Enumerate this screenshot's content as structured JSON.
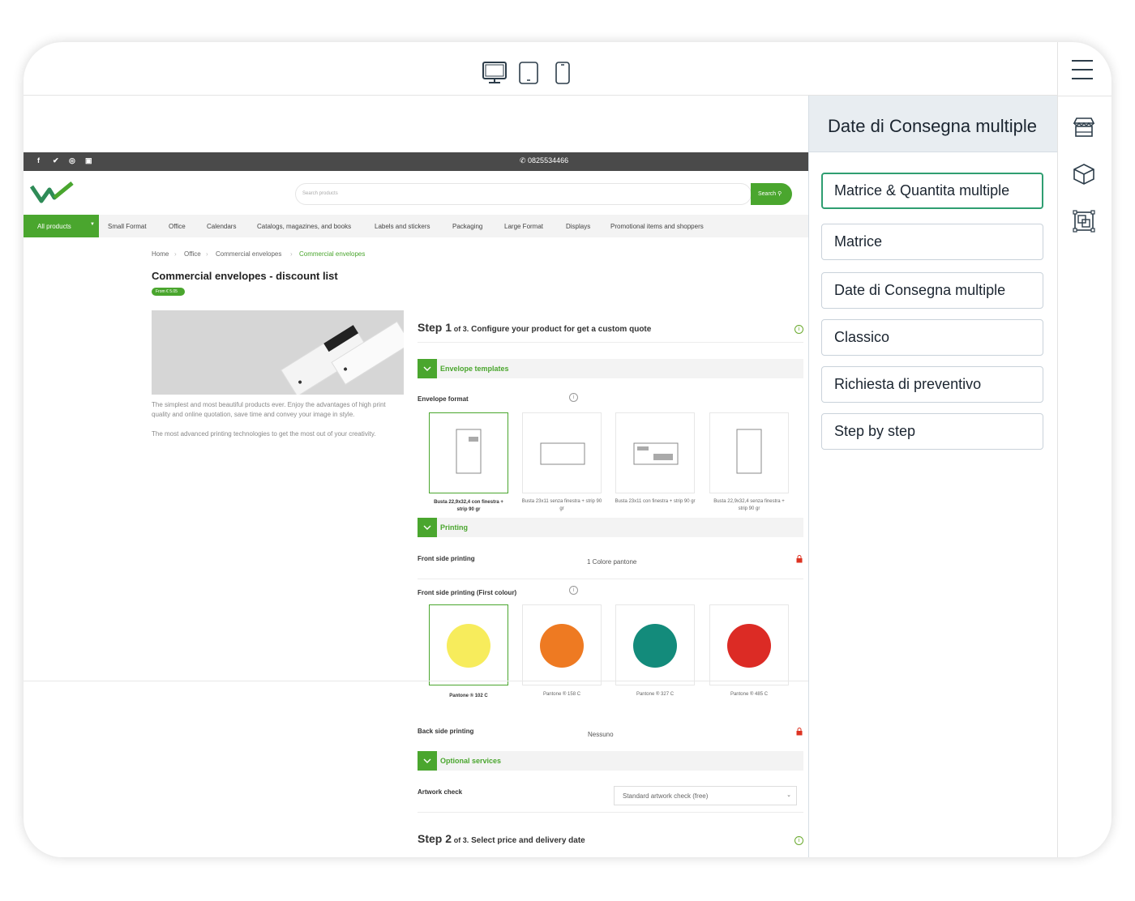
{
  "builder": {
    "device_toggles": [
      "desktop-icon",
      "tablet-icon",
      "mobile-icon"
    ],
    "panel_title": "Date di Consegna multiple",
    "options": [
      {
        "label": "Matrice & Quantita multiple",
        "active": true
      },
      {
        "label": "Matrice",
        "active": false
      },
      {
        "label": "Date di Consegna multiple",
        "active": false
      },
      {
        "label": "Classico",
        "active": false
      },
      {
        "label": "Richiesta di preventivo",
        "active": false
      },
      {
        "label": "Step by step",
        "active": false
      }
    ],
    "rail_icons": [
      "menu-icon",
      "store-icon",
      "box-icon",
      "template-icon"
    ]
  },
  "site": {
    "phone": "✆ 0825534466",
    "social_icons": [
      "facebook-icon",
      "twitter-icon",
      "instagram-icon",
      "youtube-icon"
    ],
    "search_placeholder": "Search products",
    "search_button": "Search",
    "nav_all": "All products",
    "nav": [
      "Small Format",
      "Office",
      "Calendars",
      "Catalogs, magazines, and books",
      "Labels and stickers",
      "Packaging",
      "Large Format",
      "Displays",
      "Promotional items and shoppers"
    ],
    "breadcrumb": [
      "Home",
      "Office",
      "Commercial envelopes",
      "Commercial envelopes"
    ],
    "product_title": "Commercial envelopes - discount list",
    "price_badge": "From € 5.05",
    "description_1": "The simplest and most beautiful products ever. Enjoy the advantages of high print quality and online quotation, save time and convey your image in style.",
    "description_2": "The most advanced printing technologies to get the most out of your creativity.",
    "step1": {
      "num": "Step 1",
      "of": "of 3.",
      "text": "Configure your product for get a custom quote"
    },
    "step2": {
      "num": "Step 2",
      "of": "of 3.",
      "text": "Select price and delivery date"
    },
    "sections": {
      "envelope": "Envelope templates",
      "printing": "Printing",
      "optional": "Optional services"
    },
    "envelope_format_label": "Envelope format",
    "envelopes": [
      "Busta 22,9x32,4 con finestra + strip 90 gr",
      "Busta 23x11 senza finestra + strip 90 gr",
      "Busta 23x11 con finestra + strip 90 gr",
      "Busta 22,9x32,4 senza finestra + strip 90 gr"
    ],
    "front_printing_label": "Front side printing",
    "front_printing_value": "1 Colore pantone",
    "first_colour_label": "Front side printing (First colour)",
    "colours": [
      {
        "name": "Pantone ® 102 C",
        "hex": "#f7ec5c"
      },
      {
        "name": "Pantone ® 158 C",
        "hex": "#ee7a22"
      },
      {
        "name": "Pantone ® 327 C",
        "hex": "#138b7b"
      },
      {
        "name": "Pantone ® 485 C",
        "hex": "#dc2b25"
      }
    ],
    "back_printing_label": "Back side printing",
    "back_printing_value": "Nessuno",
    "artwork_label": "Artwork check",
    "artwork_value": "Standard artwork check (free)"
  },
  "colors": {
    "brand_green": "#4aa62e",
    "builder_accent": "#2f9e71",
    "panel_head_bg": "#e8edf1"
  }
}
